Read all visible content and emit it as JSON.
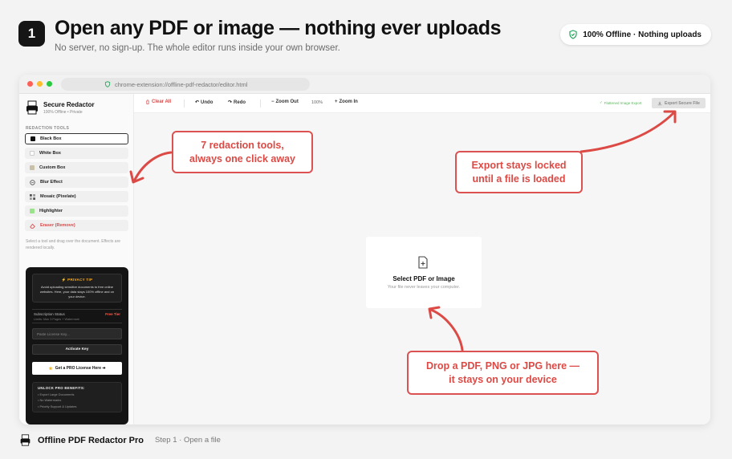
{
  "header": {
    "step_number": "1",
    "title": "Open any PDF or image — nothing ever uploads",
    "subtitle": "No server, no sign-up. The whole editor runs inside your own browser.",
    "offline_pill": "100% Offline · Nothing uploads"
  },
  "browser": {
    "url": "chrome-extension://offline-pdf-redactor/editor.html"
  },
  "sidebar": {
    "app_name": "Secure Redactor",
    "app_tagline": "100% Offline • Private",
    "section_label": "REDACTION TOOLS",
    "tools": [
      {
        "label": "Black Box",
        "color": "#111111"
      },
      {
        "label": "White Box",
        "color": "#ffffff"
      },
      {
        "label": "Custom Box",
        "color": "#c8c0a8"
      },
      {
        "label": "Blur Effect",
        "icon": "blur-icon"
      },
      {
        "label": "Mosaic (Pixelate)",
        "icon": "mosaic-icon"
      },
      {
        "label": "Highlighter",
        "color": "#9be28a"
      },
      {
        "label": "Eraser (Remove)",
        "icon": "eraser-icon"
      }
    ],
    "hint": "Select a tool and drag over the document. Effects are rendered locally.",
    "privacy_title": "⚡ PRIVACY TIP",
    "privacy_text": "Avoid uploading sensitive documents to free online websites. Here, your data stays 100% offline and on your device.",
    "subscription_label": "Subscription Status",
    "subscription_tier": "Free Tier",
    "subscription_limits": "Limits: Max 3 Pages + Watermark",
    "license_placeholder": "Paste License Key...",
    "activate_label": "Activate Key",
    "get_pro_label": "Get a PRO License Here ➔",
    "benefits_title": "UNLOCK PRO BENEFITS:",
    "benefits": [
      "• Export Large Documents",
      "• No Watermarks",
      "• Priority Support & Updates"
    ]
  },
  "toolbar": {
    "clear_all": "Clear All",
    "undo": "Undo",
    "redo": "Redo",
    "zoom_out": "Zoom Out",
    "zoom_value": "100%",
    "zoom_in": "Zoom In",
    "optimized_export": "Flattened Image Export",
    "export_label": "Export Secure File"
  },
  "canvas": {
    "drop_title": "Select PDF or Image",
    "drop_subtitle": "Your file never leaves your computer."
  },
  "callouts": {
    "tools": [
      "7 redaction tools,",
      "always one click away"
    ],
    "export": [
      "Export stays locked",
      "until a file is loaded"
    ],
    "drop": [
      "Drop a PDF, PNG or JPG here —",
      "it stays on your device"
    ]
  },
  "footer": {
    "product_name": "Offline PDF Redactor Pro",
    "step_label": "Step 1 · Open a file"
  },
  "colors": {
    "accent_red": "#dc4a45",
    "shield_green": "#22a55a",
    "dark_panel": "#141414"
  }
}
